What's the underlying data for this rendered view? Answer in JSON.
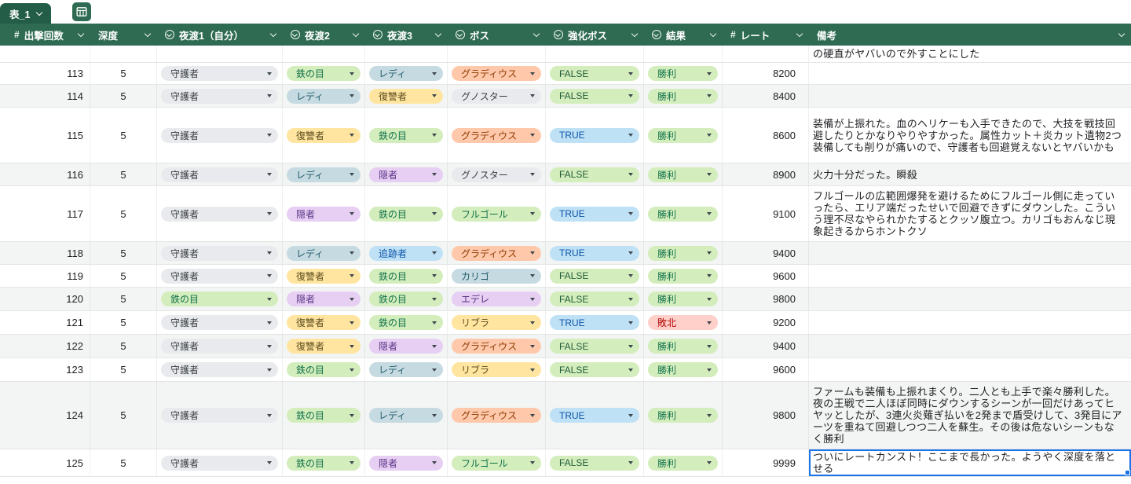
{
  "toolbar": {
    "tab_label": "表_1"
  },
  "colors": {
    "header_bg": "#2e6b52",
    "tab_bg": "#235d47",
    "band_bg": "#f2f5f3",
    "selection": "#1a73e8"
  },
  "columns": [
    {
      "id": "sortie-count",
      "type": "number",
      "label": "出撃回数"
    },
    {
      "id": "depth",
      "type": "plain",
      "label": "深度"
    },
    {
      "id": "nightfarer-1",
      "type": "dropdown",
      "label": "夜渡1（自分）"
    },
    {
      "id": "nightfarer-2",
      "type": "dropdown",
      "label": "夜渡2"
    },
    {
      "id": "nightfarer-3",
      "type": "dropdown",
      "label": "夜渡3"
    },
    {
      "id": "boss",
      "type": "dropdown",
      "label": "ボス"
    },
    {
      "id": "enhanced-boss",
      "type": "dropdown",
      "label": "強化ボス"
    },
    {
      "id": "result",
      "type": "dropdown",
      "label": "結果"
    },
    {
      "id": "rate",
      "type": "number",
      "label": "レート"
    },
    {
      "id": "note",
      "type": "plain",
      "label": "備考"
    }
  ],
  "chip_colors": {
    "守護者": {
      "bg": "#e8eaed",
      "fg": "#3c4043"
    },
    "鉄の目": {
      "bg": "#d4edbc",
      "fg": "#11734b"
    },
    "レディ": {
      "bg": "#c6dbe1",
      "fg": "#215a6c"
    },
    "復讐者": {
      "bg": "#ffe5a0",
      "fg": "#5c4b1c"
    },
    "隠者": {
      "bg": "#e6cff2",
      "fg": "#5a3286"
    },
    "追跡者": {
      "bg": "#bfe1f6",
      "fg": "#0a53a8"
    },
    "グラディウス": {
      "bg": "#ffc8aa",
      "fg": "#8a3a00"
    },
    "グノスター": {
      "bg": "#e8eaed",
      "fg": "#3c4043"
    },
    "フルゴール": {
      "bg": "#d4edbc",
      "fg": "#11734b"
    },
    "カリゴ": {
      "bg": "#c6dbe1",
      "fg": "#215a6c"
    },
    "エデレ": {
      "bg": "#e6cff2",
      "fg": "#5a3286"
    },
    "リブラ": {
      "bg": "#ffe5a0",
      "fg": "#5c4b1c"
    },
    "TRUE": {
      "bg": "#bfe1f6",
      "fg": "#0a53a8"
    },
    "FALSE": {
      "bg": "#d4edbc",
      "fg": "#1f5c38"
    },
    "勝利": {
      "bg": "#d4edbc",
      "fg": "#11734b"
    },
    "敗北": {
      "bg": "#ffcfc9",
      "fg": "#b10202"
    }
  },
  "rows": [
    {
      "num": "",
      "depth": "",
      "nw1": null,
      "nw2": null,
      "nw3": null,
      "boss": null,
      "enhanced": null,
      "result": null,
      "rate": "",
      "note": "の硬直がヤバいので外すことにした"
    },
    {
      "num": 113,
      "depth": 5,
      "nw1": "守護者",
      "nw2": "鉄の目",
      "nw3": "レディ",
      "boss": "グラディウス",
      "enhanced": "FALSE",
      "result": "勝利",
      "rate": 8200,
      "note": ""
    },
    {
      "num": 114,
      "depth": 5,
      "nw1": "守護者",
      "nw2": "レディ",
      "nw3": "復讐者",
      "boss": "グノスター",
      "enhanced": "FALSE",
      "result": "勝利",
      "rate": 8400,
      "note": ""
    },
    {
      "num": 115,
      "depth": 5,
      "nw1": "守護者",
      "nw2": "復讐者",
      "nw3": "鉄の目",
      "boss": "グラディウス",
      "enhanced": "TRUE",
      "result": "勝利",
      "rate": 8600,
      "note": "装備が上振れた。血のヘリケーも入手できたので、大技を戦技回避したりとかなりやりやすかった。属性カット＋炎カット遺物2つ装備しても削りが痛いので、守護者も回避覚えないとヤバいかも"
    },
    {
      "num": 116,
      "depth": 5,
      "nw1": "守護者",
      "nw2": "レディ",
      "nw3": "隠者",
      "boss": "グノスター",
      "enhanced": "FALSE",
      "result": "勝利",
      "rate": 8900,
      "note": "火力十分だった。瞬殺"
    },
    {
      "num": 117,
      "depth": 5,
      "nw1": "守護者",
      "nw2": "隠者",
      "nw3": "鉄の目",
      "boss": "フルゴール",
      "enhanced": "TRUE",
      "result": "勝利",
      "rate": 9100,
      "note": "フルゴールの広範囲爆発を避けるためにフルゴール側に走っていったら、エリア端だったせいで回避できずにダウンした。こういう理不尽なやられかたするとクッソ腹立つ。カリゴもおんなじ現象起きるからホントクソ"
    },
    {
      "num": 118,
      "depth": 5,
      "nw1": "守護者",
      "nw2": "レディ",
      "nw3": "追跡者",
      "boss": "グラディウス",
      "enhanced": "TRUE",
      "result": "勝利",
      "rate": 9400,
      "note": ""
    },
    {
      "num": 119,
      "depth": 5,
      "nw1": "守護者",
      "nw2": "復讐者",
      "nw3": "鉄の目",
      "boss": "カリゴ",
      "enhanced": "FALSE",
      "result": "勝利",
      "rate": 9600,
      "note": ""
    },
    {
      "num": 120,
      "depth": 5,
      "nw1": "鉄の目",
      "nw2": "隠者",
      "nw3": "鉄の目",
      "boss": "エデレ",
      "enhanced": "FALSE",
      "result": "勝利",
      "rate": 9800,
      "note": ""
    },
    {
      "num": 121,
      "depth": 5,
      "nw1": "守護者",
      "nw2": "復讐者",
      "nw3": "鉄の目",
      "boss": "リブラ",
      "enhanced": "TRUE",
      "result": "敗北",
      "rate": 9200,
      "note": ""
    },
    {
      "num": 122,
      "depth": 5,
      "nw1": "守護者",
      "nw2": "復讐者",
      "nw3": "隠者",
      "boss": "グラディウス",
      "enhanced": "FALSE",
      "result": "勝利",
      "rate": 9400,
      "note": ""
    },
    {
      "num": 123,
      "depth": 5,
      "nw1": "守護者",
      "nw2": "鉄の目",
      "nw3": "レディ",
      "boss": "リブラ",
      "enhanced": "FALSE",
      "result": "勝利",
      "rate": 9600,
      "note": ""
    },
    {
      "num": 124,
      "depth": 5,
      "nw1": "守護者",
      "nw2": "鉄の目",
      "nw3": "レディ",
      "boss": "グラディウス",
      "enhanced": "TRUE",
      "result": "勝利",
      "rate": 9800,
      "note": "ファームも装備も上振れまくり。二人とも上手で楽々勝利した。夜の王戦で二人ほぼ同時にダウンするシーンが一回だけあってヒヤッとしたが、3連火炎薙ぎ払いを2発まで盾受けして、3発目にアーツを重ねて回避しつつ二人を蘇生。その後は危ないシーンもなく勝利"
    },
    {
      "num": 125,
      "depth": 5,
      "nw1": "守護者",
      "nw2": "鉄の目",
      "nw3": "隠者",
      "boss": "フルゴール",
      "enhanced": "FALSE",
      "result": "勝利",
      "rate": 9999,
      "note": "ついにレートカンスト！ここまで長かった。ようやく深度を落とせる",
      "selected": true
    }
  ]
}
